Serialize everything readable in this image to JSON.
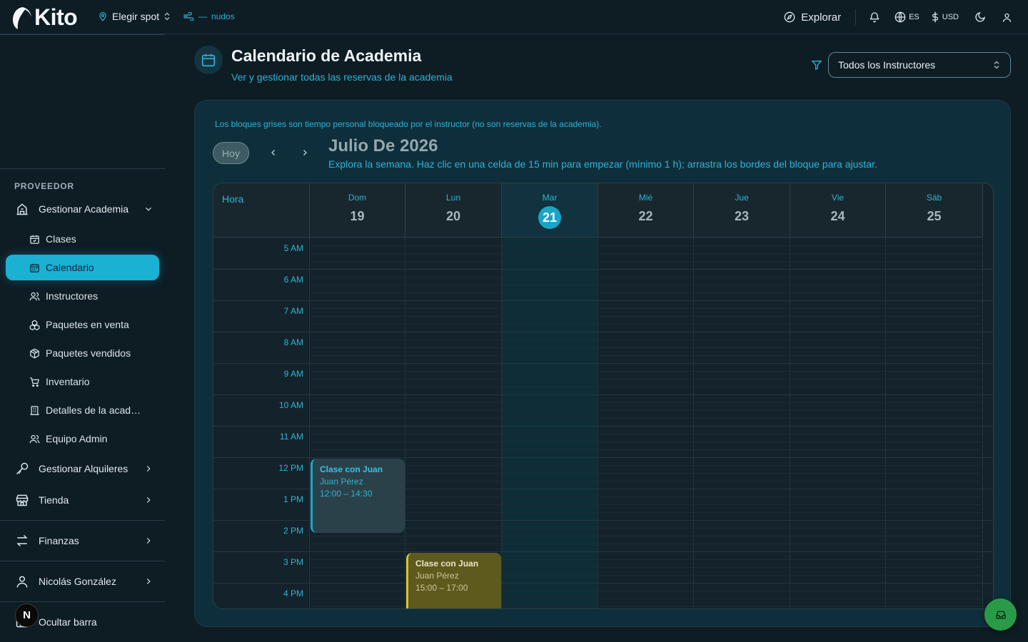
{
  "app": {
    "name": "Kito",
    "spot_label": "Elegir spot",
    "wind_value": "—",
    "wind_unit": "nudos"
  },
  "topbar": {
    "explore_label": "Explorar",
    "lang": "ES",
    "currency": "USD"
  },
  "sidebar": {
    "section": "PROVEEDOR",
    "manage_academy": "Gestionar Academia",
    "sub_items": [
      {
        "label": "Clases",
        "icon": "calendar-check-icon"
      },
      {
        "label": "Calendario",
        "icon": "calendar-icon"
      },
      {
        "label": "Instructores",
        "icon": "users-icon"
      },
      {
        "label": "Paquetes en venta",
        "icon": "packages-icon"
      },
      {
        "label": "Paquetes vendidos",
        "icon": "box-icon"
      },
      {
        "label": "Inventario",
        "icon": "cart-icon"
      },
      {
        "label": "Detalles de la academia",
        "icon": "building-icon"
      },
      {
        "label": "Equipo Admin",
        "icon": "team-icon"
      }
    ],
    "rentals": "Gestionar Alquileres",
    "shop": "Tienda",
    "finance": "Finanzas",
    "user": "Nicolás González",
    "hide": "Ocultar barra",
    "avatar_initial": "N"
  },
  "page": {
    "title": "Calendario de Academia",
    "subtitle": "Ver y gestionar todas las reservas de la academia",
    "instructor_filter": "Todos los Instructores"
  },
  "calendar": {
    "note": "Los bloques grises son tiempo personal bloqueado por el instructor (no son reservas de la academia).",
    "today_button": "Hoy",
    "month": "Julio De 2026",
    "hint": "Explora la semana. Haz clic en una celda de 15 min para empezar (mínimo 1 h); arrastra los bordes del bloque para ajustar.",
    "hour_header": "Hora",
    "days": [
      {
        "name": "Dom",
        "num": "19"
      },
      {
        "name": "Lun",
        "num": "20"
      },
      {
        "name": "Mar",
        "num": "21"
      },
      {
        "name": "Mié",
        "num": "22"
      },
      {
        "name": "Jue",
        "num": "23"
      },
      {
        "name": "Vie",
        "num": "24"
      },
      {
        "name": "Sáb",
        "num": "25"
      }
    ],
    "hours": [
      "5 AM",
      "6 AM",
      "7 AM",
      "8 AM",
      "9 AM",
      "10 AM",
      "11 AM",
      "12 PM",
      "1 PM",
      "2 PM",
      "3 PM",
      "4 PM"
    ],
    "events": [
      {
        "title": "Clase con Juan",
        "instructor": "Juan Pérez",
        "time": "12:00 – 14:30"
      },
      {
        "title": "Clase con Juan",
        "instructor": "Juan Pérez",
        "time": "15:00 – 17:00"
      }
    ]
  }
}
